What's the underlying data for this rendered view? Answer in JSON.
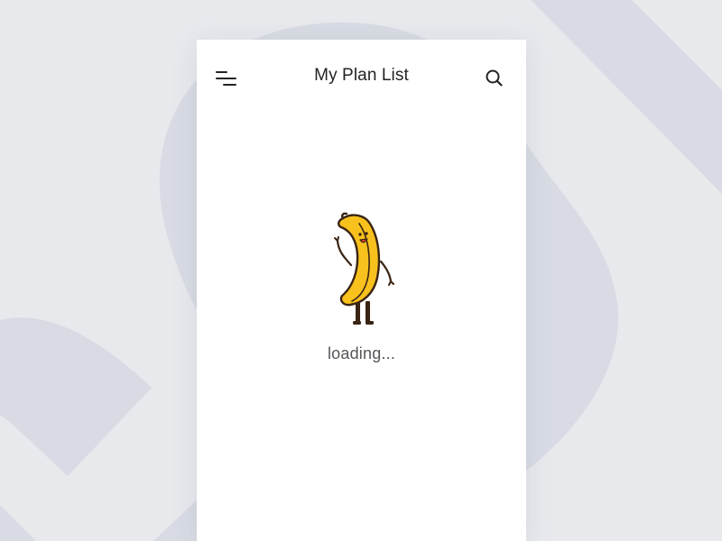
{
  "app": {
    "title": "My Plan List"
  },
  "header": {
    "menu_icon": "menu-icon",
    "search_icon": "search-icon"
  },
  "loading": {
    "text": "loading...",
    "mascot_icon": "banana-mascot-icon"
  },
  "colors": {
    "background": "#e7e9ed",
    "decor_shape": "#d8dbe3",
    "card": "#ffffff",
    "banana_yellow": "#f8c11d",
    "banana_outline": "#3a2413",
    "text_dark": "#222326",
    "text_muted": "#55565a"
  }
}
